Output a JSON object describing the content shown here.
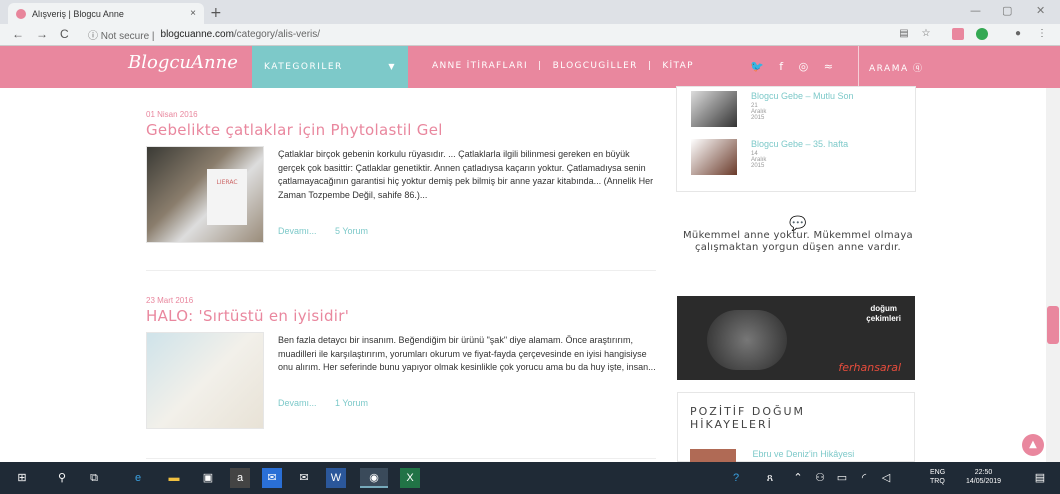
{
  "browser": {
    "tab_title": "Alışveriş | Blogcu Anne",
    "tab_close": "×",
    "new_tab": "+",
    "not_secure": "ⓘ Not secure  |",
    "url_domain": "blogcuanne.com",
    "url_path": "/category/alis-veris/"
  },
  "site": {
    "logo": "BlogcuAnne",
    "menu_kategoriler": "KATEGORILER",
    "menu_items": [
      "ANNE İTİRAFLARI",
      "BLOGCUGİLLER",
      "KİTAP"
    ],
    "menu_sep": "|",
    "arama": "ARAMA"
  },
  "posts": [
    {
      "date": "01 Nisan 2016",
      "title": "Gebelikte çatlaklar için Phytolastil Gel",
      "body": "Çatlaklar birçok gebenin korkulu rüyasıdır. ... Çatlaklarla ilgili bilinmesi gereken en büyük gerçek çok basittir: Çatlaklar genetiktir. Annen çatladıysa kaçarın yoktur. Çatlamadıysa senin çatlamayacağının garantisi hiç yoktur demiş pek bilmiş bir anne yazar kitabında... (Annelik Her Zaman Tozpembe Değil, sahife 86.)...",
      "more": "Devamı...",
      "comments": "5 Yorum",
      "img_label": "LIERAC"
    },
    {
      "date": "23 Mart 2016",
      "title": "HALO: 'Sırtüstü en iyisidir'",
      "body": "Ben fazla detaycı bir insanım. Beğendiğim bir ürünü \"şak\" diye alamam. Önce araştırırım, muadilleri ile karşılaştırırım, yorumları okurum ve fiyat-fayda çerçevesinde en iyisi hangisiyse onu alırım. Her seferinde bunu yapıyor olmak kesinlikle çok yorucu ama bu da huy işte, insan...",
      "more": "Devamı...",
      "comments": "1 Yorum"
    }
  ],
  "sidebar": {
    "recent": [
      {
        "title": "Blogcu Gebe – Mutlu Son",
        "date": "21 Aralık 2015"
      },
      {
        "title": "Blogcu Gebe – 35. hafta",
        "date": "14 Aralık 2015"
      }
    ],
    "quote": "Mükemmel anne yoktur. Mükemmel olmaya çalışmaktan yorgun düşen anne vardır.",
    "ad_line1": "doğum",
    "ad_line2": "çekimleri",
    "ad_brand": "ferhansaral",
    "pozitif_title": "POZİTİF DOĞUM HİKAYELERİ",
    "pozitif_item": "Ebru ve Deniz'in Hikâyesi"
  },
  "taskbar": {
    "lang1": "ENG",
    "lang2": "TRQ",
    "time": "22:50",
    "date": "14/05/2019"
  },
  "colors": {
    "pink": "#e9879e",
    "teal": "#7dc9c9"
  }
}
